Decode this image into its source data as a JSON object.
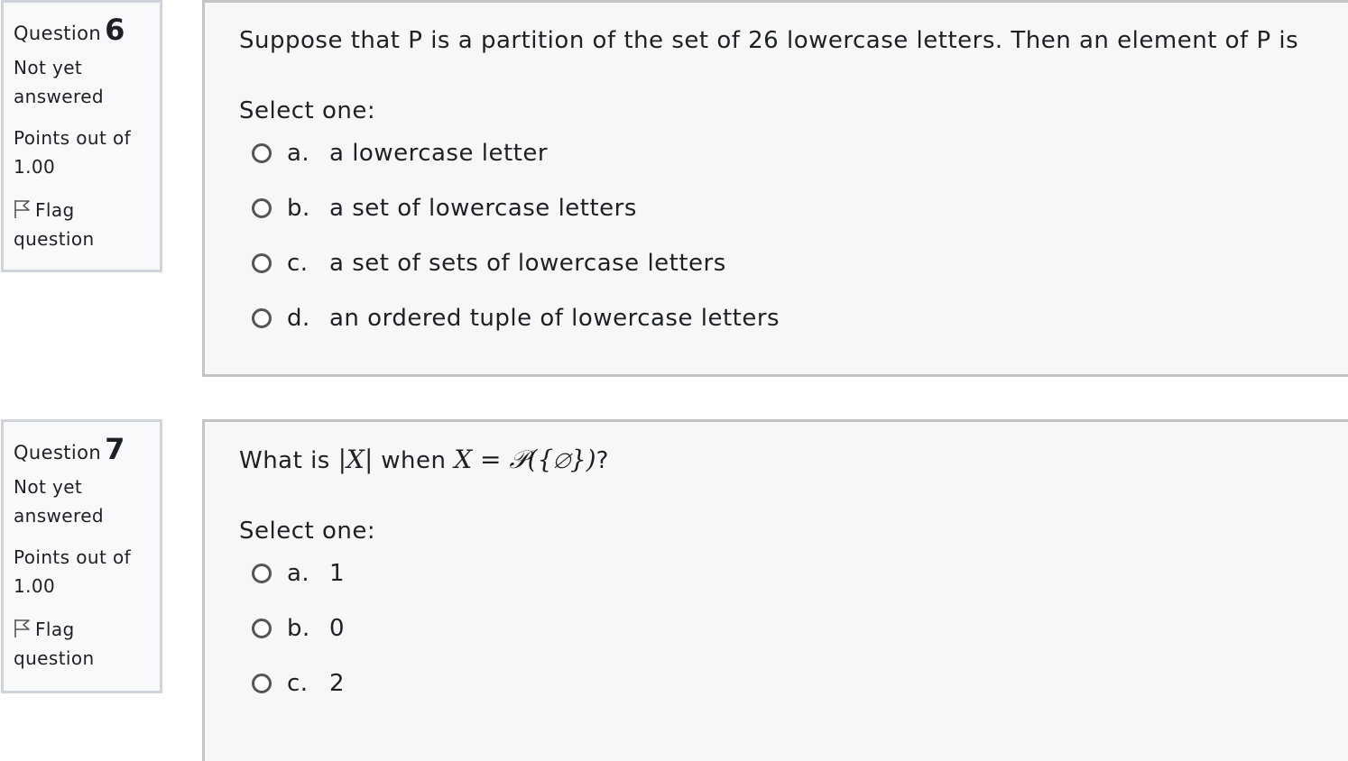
{
  "questions": [
    {
      "label": "Question",
      "number": "6",
      "state": "Not yet answered",
      "grade": "Points out of 1.00",
      "flag": "Flag question",
      "text": "Suppose that P is a partition of the set of 26 lowercase letters.  Then an element of P is",
      "prompt": "Select one:",
      "answers": [
        {
          "letter": "a.",
          "text": "a lowercase letter"
        },
        {
          "letter": "b.",
          "text": "a set of lowercase letters"
        },
        {
          "letter": "c.",
          "text": "a set of sets of lowercase letters"
        },
        {
          "letter": "d.",
          "text": "an ordered tuple of lowercase letters"
        }
      ]
    },
    {
      "label": "Question",
      "number": "7",
      "state": "Not yet answered",
      "grade": "Points out of 1.00",
      "flag": "Flag question",
      "text_before": "What is ",
      "math_1": "|X|",
      "text_mid": " when ",
      "math_2": "X = 𝒫({∅})",
      "text_after": "?",
      "prompt": "Select one:",
      "answers": [
        {
          "letter": "a.",
          "text": "1"
        },
        {
          "letter": "b.",
          "text": "0"
        },
        {
          "letter": "c.",
          "text": "2"
        }
      ]
    }
  ]
}
